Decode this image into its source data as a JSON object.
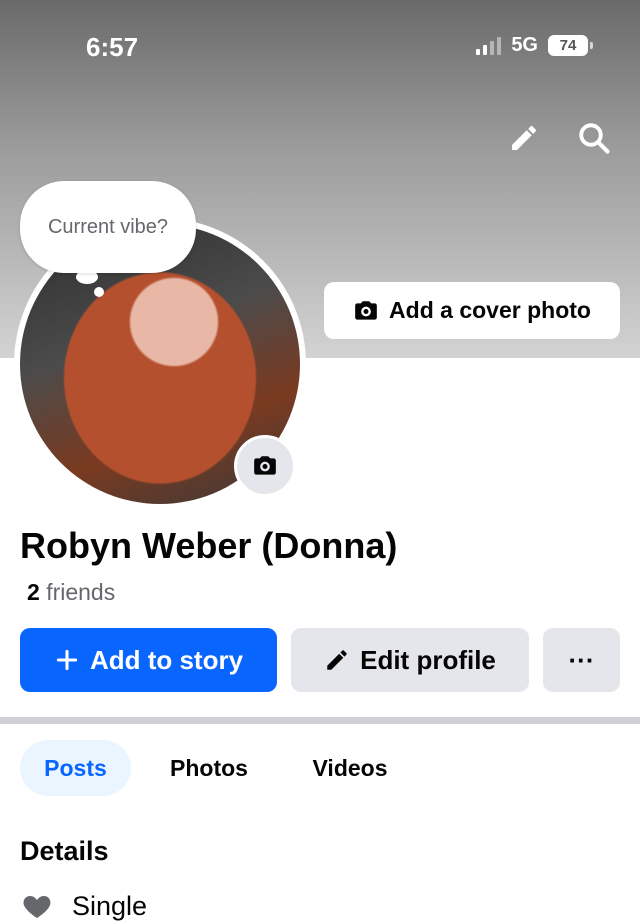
{
  "status_bar": {
    "time": "6:57",
    "network": "5G",
    "battery": "74"
  },
  "top_actions": {
    "edit_icon": "pencil-icon",
    "search_icon": "search-icon"
  },
  "profile": {
    "vibe_prompt": "Current vibe?",
    "add_cover_label": "Add a cover photo",
    "name": "Robyn Weber (Donna)",
    "friends_count": "2",
    "friends_label": "friends"
  },
  "actions": {
    "add_story_label": "Add to story",
    "edit_profile_label": "Edit profile",
    "more_label": "···"
  },
  "tabs": [
    {
      "label": "Posts",
      "active": true
    },
    {
      "label": "Photos",
      "active": false
    },
    {
      "label": "Videos",
      "active": false
    }
  ],
  "details": {
    "title": "Details",
    "items": [
      {
        "icon": "heart-icon",
        "text": "Single"
      }
    ]
  },
  "colors": {
    "accent": "#0866ff",
    "secondary_button": "#e4e6eb",
    "active_tab_bg": "#ebf5ff"
  }
}
